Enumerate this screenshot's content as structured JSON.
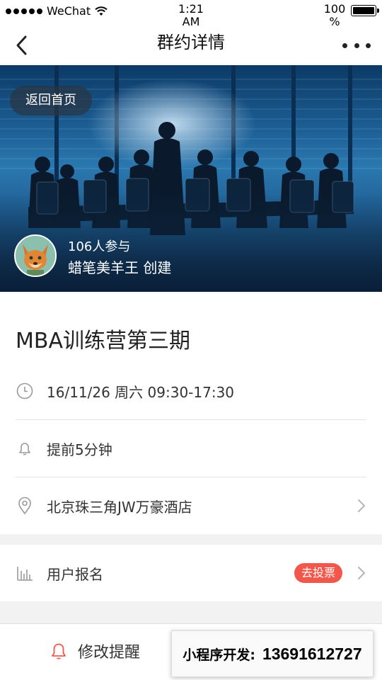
{
  "status_bar": {
    "carrier": "WeChat",
    "time": "1:21 AM",
    "battery": "100 %"
  },
  "nav": {
    "title": "群约详情",
    "back_icon": "chevron-left-icon",
    "more_icon": "more-dots-icon"
  },
  "banner": {
    "home_button": "返回首页",
    "participants": "106人参与",
    "creator": "蜡笔美羊王 创建"
  },
  "event": {
    "title": "MBA训练营第三期",
    "datetime": "16/11/26 周六 09:30-17:30",
    "reminder": "提前5分钟",
    "location": "北京珠三角JW万豪酒店"
  },
  "signup": {
    "label": "用户报名",
    "vote_badge": "去投票"
  },
  "bottom": {
    "edit_reminder": "修改提醒"
  },
  "promo": {
    "label": "小程序开发:",
    "phone": "13691612727"
  },
  "colors": {
    "accent": "#f2574b",
    "icon_gray": "#9a9a9a"
  }
}
